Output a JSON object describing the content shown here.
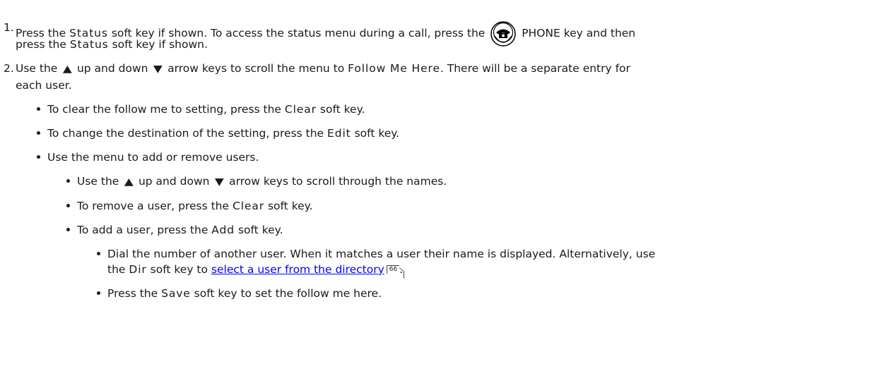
{
  "steps": [
    {
      "number": "1.",
      "line1": {
        "t1": "Press the ",
        "k1": "Status",
        "t2": " soft key if shown. To access the status menu during a call, press the ",
        "icon": "phone-key-icon",
        "t3": " PHONE key and then"
      },
      "line2": {
        "t1": "press the ",
        "k1": "Status",
        "t2": " soft key if shown."
      }
    },
    {
      "number": "2.",
      "line1": {
        "t1": "Use the ",
        "up_icon": "up-arrow-icon",
        "t2": " up and down ",
        "down_icon": "down-arrow-icon",
        "t3": " arrow keys to scroll the menu to ",
        "k1": "Follow Me Here",
        "t4": ". There will be a separate entry for"
      },
      "line2": {
        "t1": "each user."
      }
    }
  ],
  "level1_bullets": [
    {
      "t1": "To clear the follow me to setting, press the ",
      "k1": "Clear",
      "t2": " soft key."
    },
    {
      "t1": "To change the destination of the setting, press the ",
      "k1": "Edit",
      "t2": " soft key."
    },
    {
      "t1": "Use the menu to add or remove users."
    }
  ],
  "level2_bullets": [
    {
      "t1": "Use the ",
      "t2": " up and down ",
      "t3": " arrow keys to scroll through the names."
    },
    {
      "t1": "To remove a user, press the ",
      "k1": "Clear",
      "t2": " soft key."
    },
    {
      "t1": "To add a user, press the ",
      "k1": "Add",
      "t2": " soft key."
    }
  ],
  "level3_bullets": [
    {
      "line1": "Dial the number of another user. When it matches a user their name is displayed.  Alternatively, use",
      "line2_t1": "the ",
      "line2_k1": "Dir",
      "line2_t2": " soft key to ",
      "link": "select a user from the directory",
      "page_ref": "66",
      "line2_t3": "."
    },
    {
      "t1": "Press the ",
      "k1": "Save",
      "t2": " soft key to set the follow me here."
    }
  ],
  "icons": {
    "up_arrow_glyph": "▲",
    "down_arrow_glyph": "▼"
  },
  "colors": {
    "text": "#1a1a1a",
    "link": "#0000ff"
  }
}
